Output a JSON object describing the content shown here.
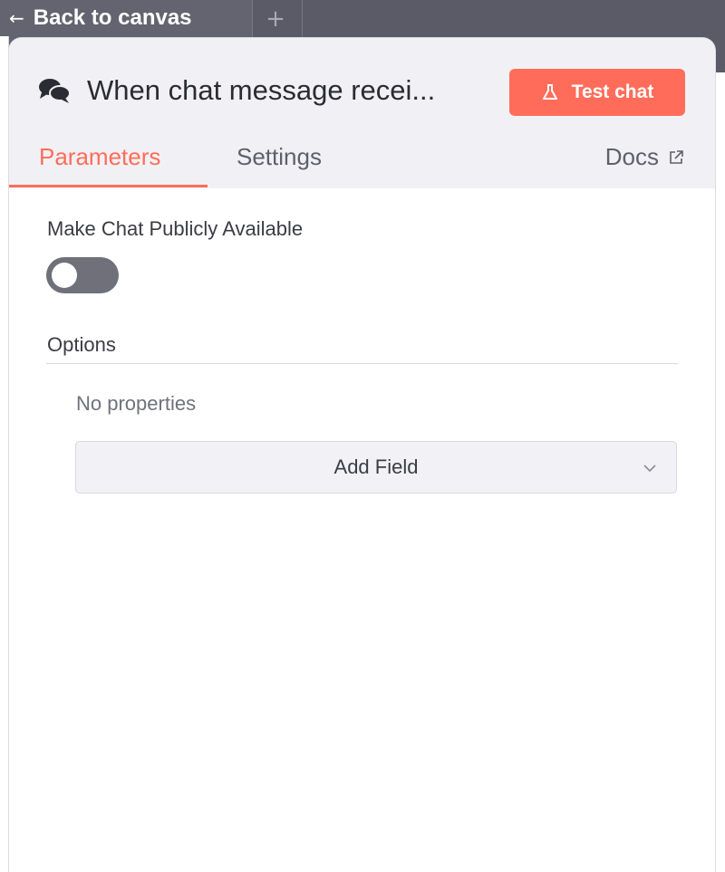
{
  "header": {
    "back_label": "Back to canvas",
    "back_icon": "arrow-left-icon",
    "add_tab_icon": "plus-icon"
  },
  "panel": {
    "title": "When chat message recei...",
    "title_icon": "chat-bubbles-icon",
    "test_button": {
      "label": "Test chat",
      "icon": "flask-icon"
    },
    "tabs": [
      {
        "label": "Parameters",
        "active": true
      },
      {
        "label": "Settings",
        "active": false
      }
    ],
    "docs": {
      "label": "Docs",
      "icon": "external-link-icon"
    }
  },
  "parameters": {
    "public_label": "Make Chat Publicly Available",
    "public_enabled": false,
    "options_label": "Options",
    "no_properties_text": "No properties",
    "add_field_label": "Add Field"
  },
  "colors": {
    "accent": "#ff6d5a",
    "toggle_off": "#6f707a",
    "header_bg": "#f1f1f5",
    "canvas_bg": "#5a5b66"
  }
}
